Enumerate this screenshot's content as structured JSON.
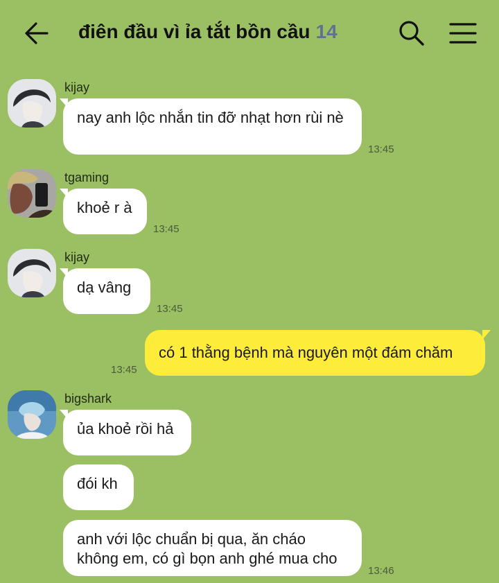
{
  "header": {
    "title": "điên đầu vì ỉa tắt bồn cầu",
    "member_count": "14",
    "back_icon": "arrow-left-icon",
    "search_icon": "search-icon",
    "menu_icon": "hamburger-menu-icon"
  },
  "colors": {
    "background": "#9bc063",
    "incoming_bubble": "#ffffff",
    "outgoing_bubble": "#fdec3a",
    "member_count": "#5f7391"
  },
  "messages": [
    {
      "sender": "kijay",
      "text": "nay anh lộc nhắn tin đỡ nhạt hơn rùi nè",
      "time": "13:45"
    },
    {
      "sender": "tgaming",
      "text": "khoẻ r à",
      "time": "13:45"
    },
    {
      "sender": "kijay",
      "text": "dạ vâng",
      "time": "13:45"
    },
    {
      "sender": "me",
      "text": "có 1 thằng bệnh mà nguyên một đám chăm",
      "time": "13:45"
    },
    {
      "sender": "bigshark",
      "text": "ủa khoẻ rồi hả"
    },
    {
      "text": "đói kh"
    },
    {
      "text": "anh với lộc chuẩn bị qua, ăn cháo không em, có gì bọn anh ghé mua cho",
      "time": "13:46"
    }
  ]
}
